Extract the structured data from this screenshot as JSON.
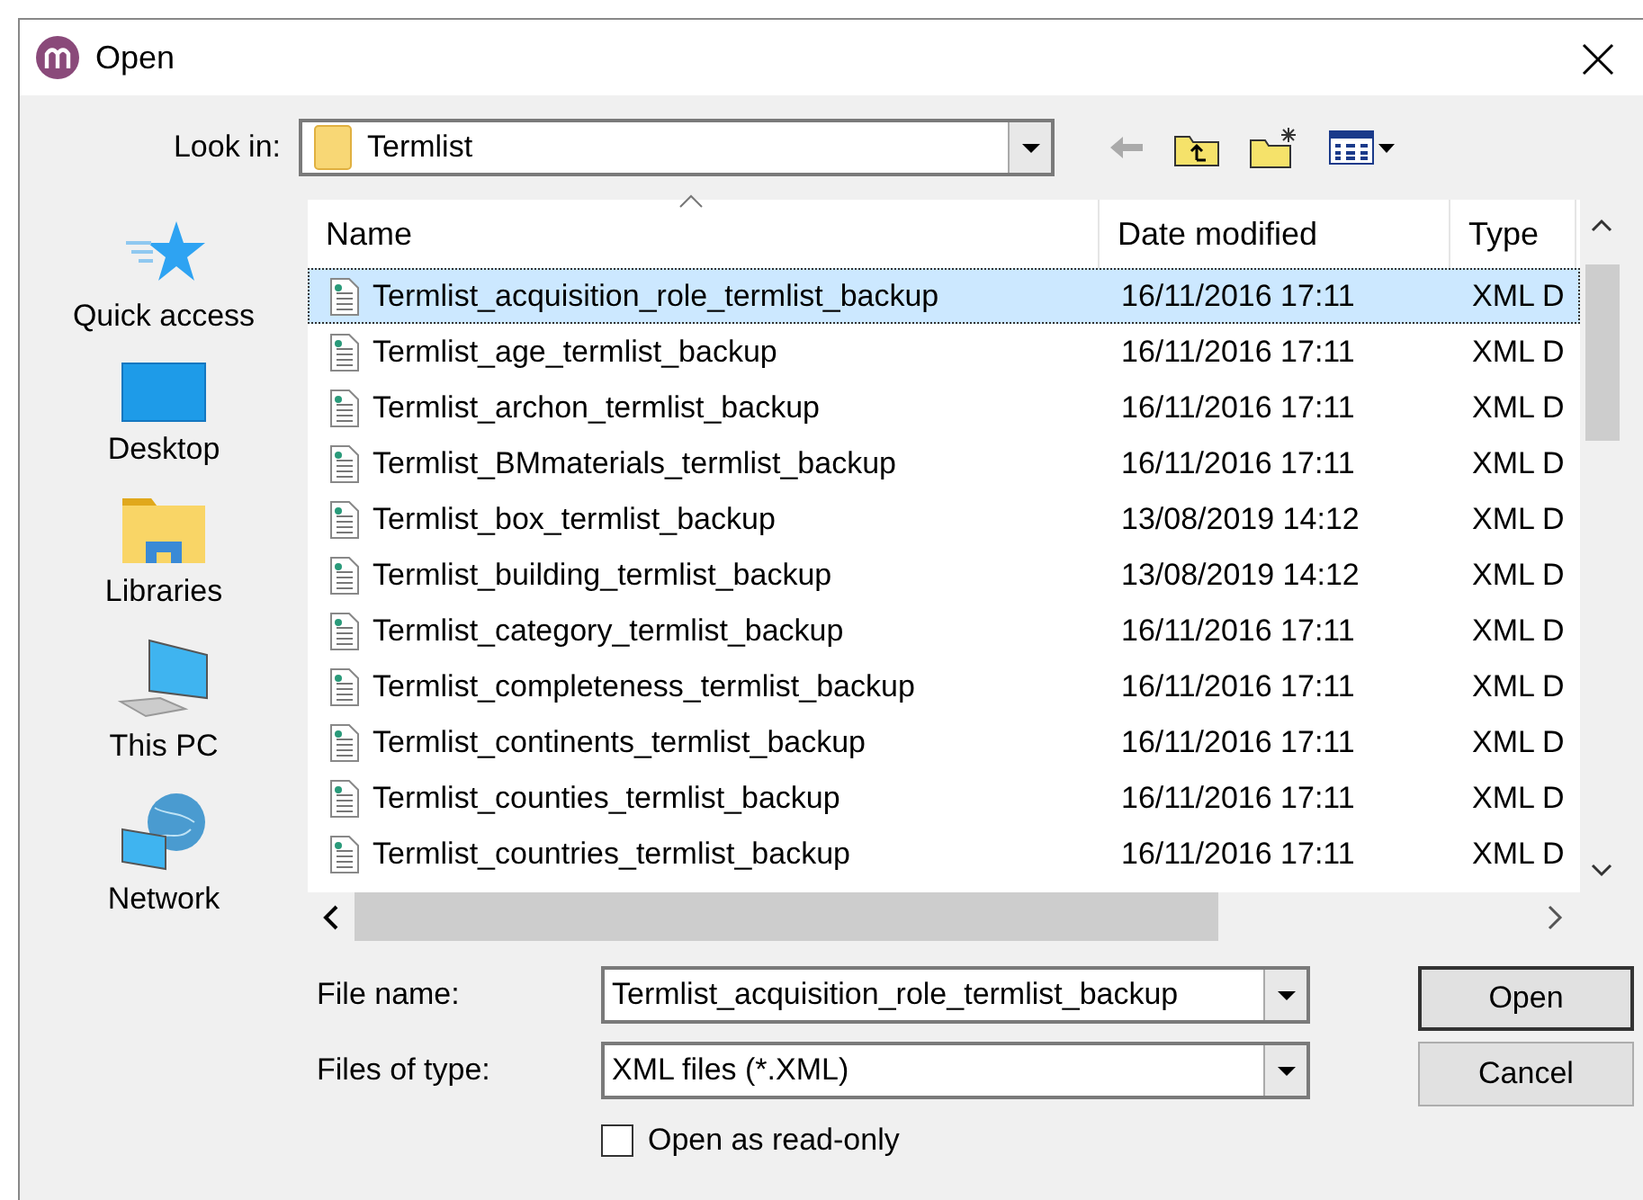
{
  "window": {
    "title": "Open"
  },
  "look_in": {
    "label": "Look in:",
    "value": "Termlist"
  },
  "places": [
    {
      "label": "Quick access",
      "kind": "star"
    },
    {
      "label": "Desktop",
      "kind": "desktop"
    },
    {
      "label": "Libraries",
      "kind": "libraries"
    },
    {
      "label": "This PC",
      "kind": "pc"
    },
    {
      "label": "Network",
      "kind": "network"
    }
  ],
  "table": {
    "columns": [
      "Name",
      "Date modified",
      "Type"
    ],
    "rows": [
      {
        "name": "Termlist_acquisition_role_termlist_backup",
        "date": "16/11/2016 17:11",
        "type": "XML D",
        "selected": true
      },
      {
        "name": "Termlist_age_termlist_backup",
        "date": "16/11/2016 17:11",
        "type": "XML D",
        "selected": false
      },
      {
        "name": "Termlist_archon_termlist_backup",
        "date": "16/11/2016 17:11",
        "type": "XML D",
        "selected": false
      },
      {
        "name": "Termlist_BMmaterials_termlist_backup",
        "date": "16/11/2016 17:11",
        "type": "XML D",
        "selected": false
      },
      {
        "name": "Termlist_box_termlist_backup",
        "date": "13/08/2019 14:12",
        "type": "XML D",
        "selected": false
      },
      {
        "name": "Termlist_building_termlist_backup",
        "date": "13/08/2019 14:12",
        "type": "XML D",
        "selected": false
      },
      {
        "name": "Termlist_category_termlist_backup",
        "date": "16/11/2016 17:11",
        "type": "XML D",
        "selected": false
      },
      {
        "name": "Termlist_completeness_termlist_backup",
        "date": "16/11/2016 17:11",
        "type": "XML D",
        "selected": false
      },
      {
        "name": "Termlist_continents_termlist_backup",
        "date": "16/11/2016 17:11",
        "type": "XML D",
        "selected": false
      },
      {
        "name": "Termlist_counties_termlist_backup",
        "date": "16/11/2016 17:11",
        "type": "XML D",
        "selected": false
      },
      {
        "name": "Termlist_countries_termlist_backup",
        "date": "16/11/2016 17:11",
        "type": "XML D",
        "selected": false
      }
    ]
  },
  "file_name": {
    "label": "File name:",
    "value": "Termlist_acquisition_role_termlist_backup"
  },
  "file_type": {
    "label": "Files of type:",
    "value": "XML files (*.XML)"
  },
  "read_only": {
    "label": "Open as read-only",
    "checked": false
  },
  "buttons": [
    "Open",
    "Cancel"
  ]
}
